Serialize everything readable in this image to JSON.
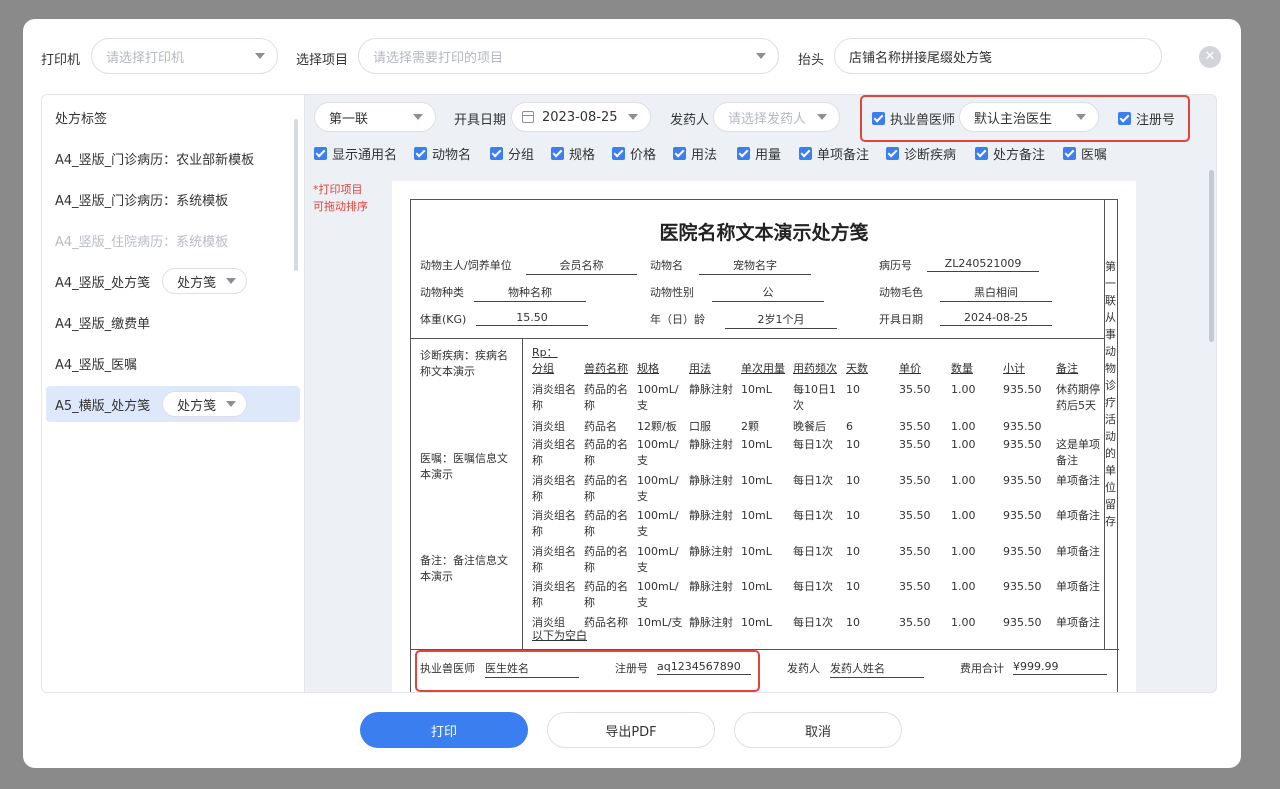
{
  "topbar": {
    "printer_label": "打印机",
    "printer_placeholder": "请选择打印机",
    "items_label": "选择项目",
    "items_placeholder": "请选择需要打印的项目",
    "header_label": "抬头",
    "header_value": "店铺名称拼接尾缀处方笺"
  },
  "templates": {
    "title": "处方标签",
    "items": [
      {
        "label": "A4_竖版_门诊病历：农业部新模板"
      },
      {
        "label": "A4_竖版_门诊病历：系统模板"
      },
      {
        "label": "A4_竖版_住院病历：系统模板"
      },
      {
        "label": "A4_竖版_处方笺",
        "chip": "处方笺"
      },
      {
        "label": "A4_竖版_缴费单"
      },
      {
        "label": "A4_竖版_医嘱"
      },
      {
        "label": "A5_横版_处方笺",
        "chip": "处方笺"
      }
    ]
  },
  "options": {
    "copy_select": "第一联",
    "date_label": "开具日期",
    "date_value": "2023-08-25",
    "dispenser_label": "发药人",
    "dispenser_placeholder": "请选择发药人",
    "vet_label": "执业兽医师",
    "vet_select": "默认主治医生",
    "reg_label": "注册号",
    "checkboxes": [
      "显示通用名",
      "动物名",
      "分组",
      "规格",
      "价格",
      "用法",
      "用量",
      "单项备注",
      "诊断疾病",
      "处方备注",
      "医嘱"
    ]
  },
  "hint": {
    "line1": "*打印项目",
    "line2": "可拖动排序"
  },
  "prescription": {
    "title": "医院名称文本演示处方笺",
    "owner_label": "动物主人/饲养单位",
    "owner_value": "会员名称",
    "animal_name_label": "动物名",
    "animal_name_value": "宠物名字",
    "record_label": "病历号",
    "record_value": "ZL240521009",
    "species_label": "动物种类",
    "species_value": "物种名称",
    "gender_label": "动物性别",
    "gender_value": "公",
    "coat_label": "动物毛色",
    "coat_value": "黑白相间",
    "weight_label": "体重(KG)",
    "weight_value": "15.50",
    "age_label": "年（日）龄",
    "age_value": "2岁1个月",
    "issue_date_label": "开具日期",
    "issue_date_value": "2024-08-25",
    "side_text": "第一联从事动物诊疗活动的单位留存",
    "diagnosis": "诊断疾病：疾病名称文本演示",
    "advice": "医嘱：医嘱信息文本演示",
    "remark": "备注：备注信息文本演示",
    "rp": "Rp：",
    "columns": [
      "分组",
      "兽药名称",
      "规格",
      "用法",
      "单次用量",
      "用药频次",
      "天数",
      "单价",
      "数量",
      "小计",
      "备注"
    ],
    "rows": [
      [
        "消炎组名称",
        "药品的名称",
        "100mL/支",
        "静脉注射",
        "10mL",
        "每10日1次",
        "10",
        "35.50",
        "1.00",
        "935.50",
        "休药期停药后5天"
      ],
      [
        "消炎组",
        "药品名",
        "12颗/板",
        "口服",
        "2颗",
        "晚餐后",
        "6",
        "35.50",
        "1.00",
        "935.50",
        ""
      ],
      [
        "消炎组名称",
        "药品的名称",
        "100mL/支",
        "静脉注射",
        "10mL",
        "每日1次",
        "10",
        "35.50",
        "1.00",
        "935.50",
        "这是单项备注"
      ],
      [
        "消炎组名称",
        "药品的名称",
        "100mL/支",
        "静脉注射",
        "10mL",
        "每日1次",
        "10",
        "35.50",
        "1.00",
        "935.50",
        "单项备注"
      ],
      [
        "消炎组名称",
        "药品的名称",
        "100mL/支",
        "静脉注射",
        "10mL",
        "每日1次",
        "10",
        "35.50",
        "1.00",
        "935.50",
        "单项备注"
      ],
      [
        "消炎组名称",
        "药品的名称",
        "100mL/支",
        "静脉注射",
        "10mL",
        "每日1次",
        "10",
        "35.50",
        "1.00",
        "935.50",
        "单项备注"
      ],
      [
        "消炎组名称",
        "药品的名称",
        "100mL/支",
        "静脉注射",
        "10mL",
        "每日1次",
        "10",
        "35.50",
        "1.00",
        "935.50",
        "单项备注"
      ],
      [
        "消炎组",
        "药品名称",
        "10mL/支",
        "静脉注射",
        "10mL",
        "每日1次",
        "10",
        "35.50",
        "1.00",
        "935.50",
        "单项备注"
      ]
    ],
    "blank_text": "以下为空白",
    "vet_label": "执业兽医师",
    "vet_value": "医生姓名",
    "reg_label": "注册号",
    "reg_value": "aq1234567890",
    "dispenser_label": "发药人",
    "dispenser_value": "发药人姓名",
    "total_label": "费用合计",
    "total_value": "¥999.99"
  },
  "actions": {
    "print": "打印",
    "export": "导出PDF",
    "cancel": "取消"
  },
  "colors": {
    "primary": "#3b7ef0",
    "highlight": "#e0443c",
    "active_bg": "#dde9fb"
  }
}
